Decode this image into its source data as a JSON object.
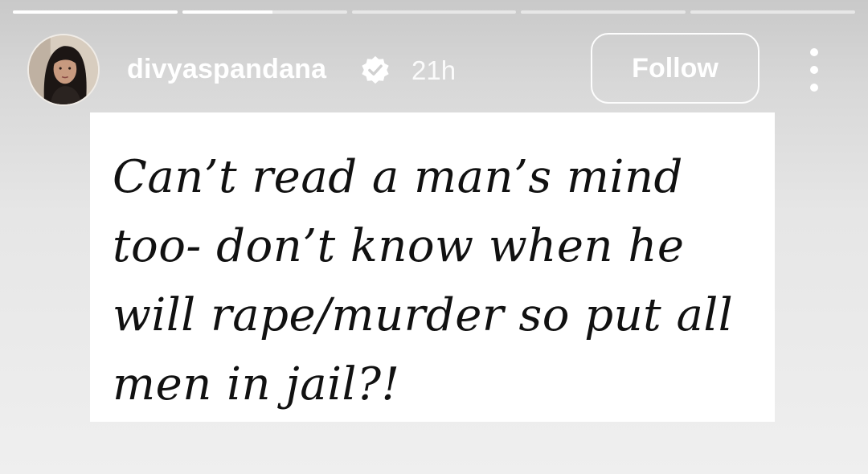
{
  "story": {
    "progress": [
      1.0,
      0.55,
      0.0,
      0.0,
      0.0
    ]
  },
  "header": {
    "username": "divyaspandana",
    "verified": true,
    "time": "21h",
    "follow_label": "Follow",
    "avatar_icon": "profile-photo",
    "more_icon": "more-vertical-icon"
  },
  "post": {
    "text": "Can’t read a man’s mind too- don’t know when he will rape/murder so put all men in jail?!"
  }
}
